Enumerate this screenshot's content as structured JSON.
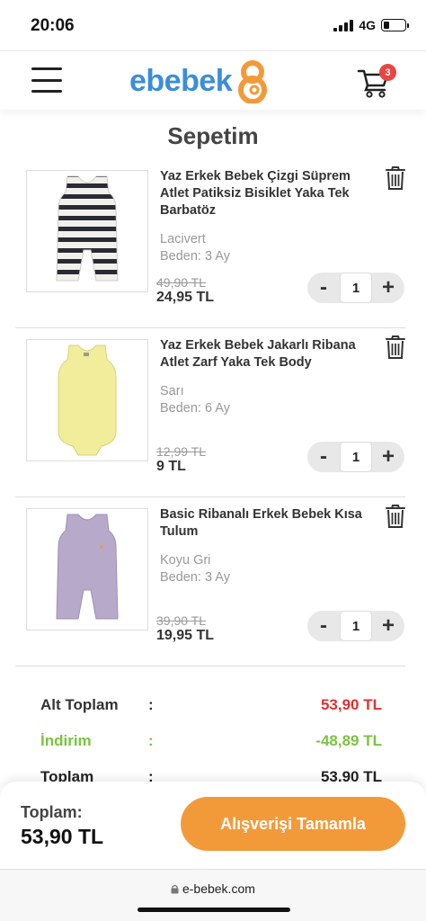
{
  "status": {
    "time": "20:06",
    "network": "4G"
  },
  "header": {
    "logo_text": "ebebek",
    "cart_count": "3"
  },
  "page_title": "Sepetim",
  "items": [
    {
      "name": "Yaz Erkek Bebek Çizgi Süprem Atlet Patiksiz Bisiklet Yaka Tek Barbatöz",
      "color": "Lacivert",
      "size": "Beden: 3 Ay",
      "old_price": "49,90 TL",
      "price": "24,95 TL",
      "qty": "1"
    },
    {
      "name": "Yaz Erkek Bebek Jakarlı Ribana Atlet Zarf Yaka Tek Body",
      "color": "Sarı",
      "size": "Beden: 6 Ay",
      "old_price": "12,99 TL",
      "price": "9 TL",
      "qty": "1"
    },
    {
      "name": "Basic Ribanalı Erkek Bebek Kısa Tulum",
      "color": "Koyu Gri",
      "size": "Beden: 3 Ay",
      "old_price": "39,90 TL",
      "price": "19,95 TL",
      "qty": "1"
    }
  ],
  "stepper": {
    "minus": "-",
    "plus": "+"
  },
  "summary": {
    "subtotal_label": "Alt Toplam",
    "subtotal_value": "53,90 TL",
    "discount_label": "İndirim",
    "discount_value": "-48,89 TL",
    "total_label": "Toplam",
    "total_value": "53,90 TL",
    "colon": ":"
  },
  "bottom": {
    "total_label": "Toplam:",
    "total_value": "53,90 TL",
    "checkout_label": "Alışverişi Tamamla"
  },
  "browser": {
    "url": "e-bebek.com"
  },
  "colors": {
    "brand_blue": "#3b8ed8",
    "brand_orange": "#f29a3a",
    "subtotal_red": "#e03030",
    "discount_green": "#7cc242",
    "badge_red": "#e84545"
  }
}
